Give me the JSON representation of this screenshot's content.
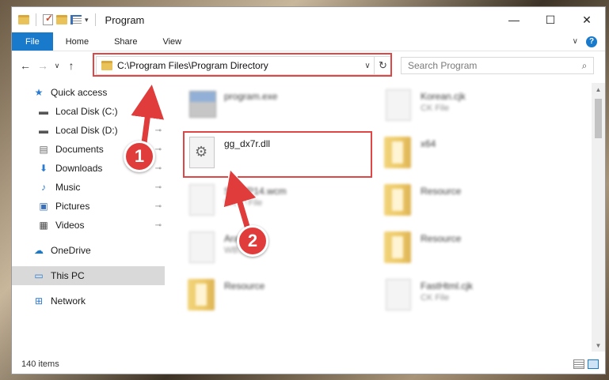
{
  "window": {
    "title": "Program",
    "controls": {
      "minimize": "—",
      "maximize": "☐",
      "close": "✕"
    }
  },
  "ribbon": {
    "tabs": [
      "File",
      "Home",
      "Share",
      "View"
    ],
    "expand": "∨",
    "help": "?"
  },
  "nav": {
    "back": "←",
    "forward": "→",
    "recent": "∨",
    "up": "↑",
    "address": "C:\\Program Files\\Program Directory",
    "address_dropdown": "∨",
    "refresh": "↻",
    "search_placeholder": "Search Program",
    "search_icon": "⌕"
  },
  "sidebar": {
    "items": [
      {
        "label": "Quick access",
        "icon": "star-icon",
        "glyph": "★"
      },
      {
        "label": "Local Disk (C:)",
        "icon": "drive-icon",
        "glyph": "▬",
        "pinned": true
      },
      {
        "label": "Local Disk (D:)",
        "icon": "drive-icon",
        "glyph": "▬",
        "pinned": true
      },
      {
        "label": "Documents",
        "icon": "documents-icon",
        "glyph": "▤",
        "pinned": true
      },
      {
        "label": "Downloads",
        "icon": "downloads-icon",
        "glyph": "⬇",
        "pinned": true
      },
      {
        "label": "Music",
        "icon": "music-icon",
        "glyph": "♪",
        "pinned": true
      },
      {
        "label": "Pictures",
        "icon": "pictures-icon",
        "glyph": "▣",
        "pinned": true
      },
      {
        "label": "Videos",
        "icon": "videos-icon",
        "glyph": "▦",
        "pinned": true
      },
      {
        "label": "OneDrive",
        "icon": "onedrive-icon",
        "glyph": "☁"
      },
      {
        "label": "This PC",
        "icon": "pc-icon",
        "glyph": "▭",
        "selected": true
      },
      {
        "label": "Network",
        "icon": "network-icon",
        "glyph": "⊞"
      }
    ],
    "pin_glyph": "📌"
  },
  "files": [
    {
      "name": "program.exe",
      "sub": "",
      "type": "exe"
    },
    {
      "name": "Korean.cjk",
      "sub": "CK File",
      "type": "doc"
    },
    {
      "name": "gg_dx7r.dll",
      "sub": "",
      "type": "dll"
    },
    {
      "name": "x64",
      "sub": "",
      "type": "folder"
    },
    {
      "name": "S...WP14.wcm",
      "sub": "WCM File",
      "type": "doc"
    },
    {
      "name": "Resource",
      "sub": "",
      "type": "folder"
    },
    {
      "name": "Arab...l",
      "sub": "WB...",
      "type": "doc"
    },
    {
      "name": "Resource",
      "sub": "",
      "type": "folder"
    },
    {
      "name": "Resource",
      "sub": "",
      "type": "folder"
    },
    {
      "name": "FastHtml.cjk",
      "sub": "CK File",
      "type": "doc"
    }
  ],
  "status": {
    "item_count": "140 items"
  },
  "annotations": [
    {
      "label": "1"
    },
    {
      "label": "2"
    }
  ],
  "colors": {
    "accent": "#1979ca",
    "highlight": "#e04646"
  }
}
